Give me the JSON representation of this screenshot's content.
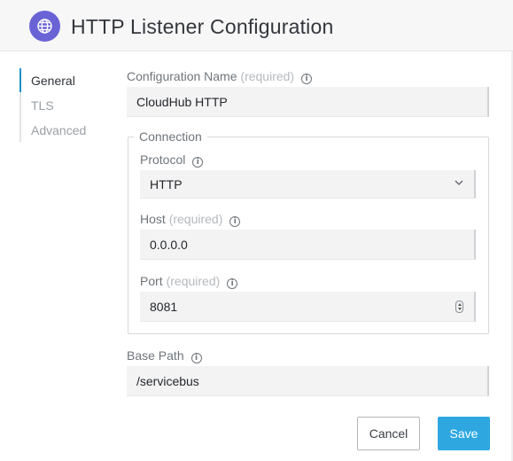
{
  "header": {
    "title": "HTTP Listener Configuration",
    "icon": "globe-icon",
    "icon_color": "#6a63d6"
  },
  "nav": {
    "items": [
      {
        "label": "General",
        "active": true
      },
      {
        "label": "TLS",
        "active": false
      },
      {
        "label": "Advanced",
        "active": false
      }
    ],
    "active_color": "#1e90c9"
  },
  "form": {
    "config_name": {
      "label": "Configuration Name",
      "required_text": "(required)",
      "value": "CloudHub HTTP"
    },
    "connection": {
      "legend": "Connection",
      "protocol": {
        "label": "Protocol",
        "value": "HTTP"
      },
      "host": {
        "label": "Host",
        "required_text": "(required)",
        "value": "0.0.0.0"
      },
      "port": {
        "label": "Port",
        "required_text": "(required)",
        "value": "8081"
      }
    },
    "base_path": {
      "label": "Base Path",
      "value": "/servicebus"
    }
  },
  "buttons": {
    "cancel": "Cancel",
    "save": "Save",
    "save_color": "#2ea7e0"
  }
}
